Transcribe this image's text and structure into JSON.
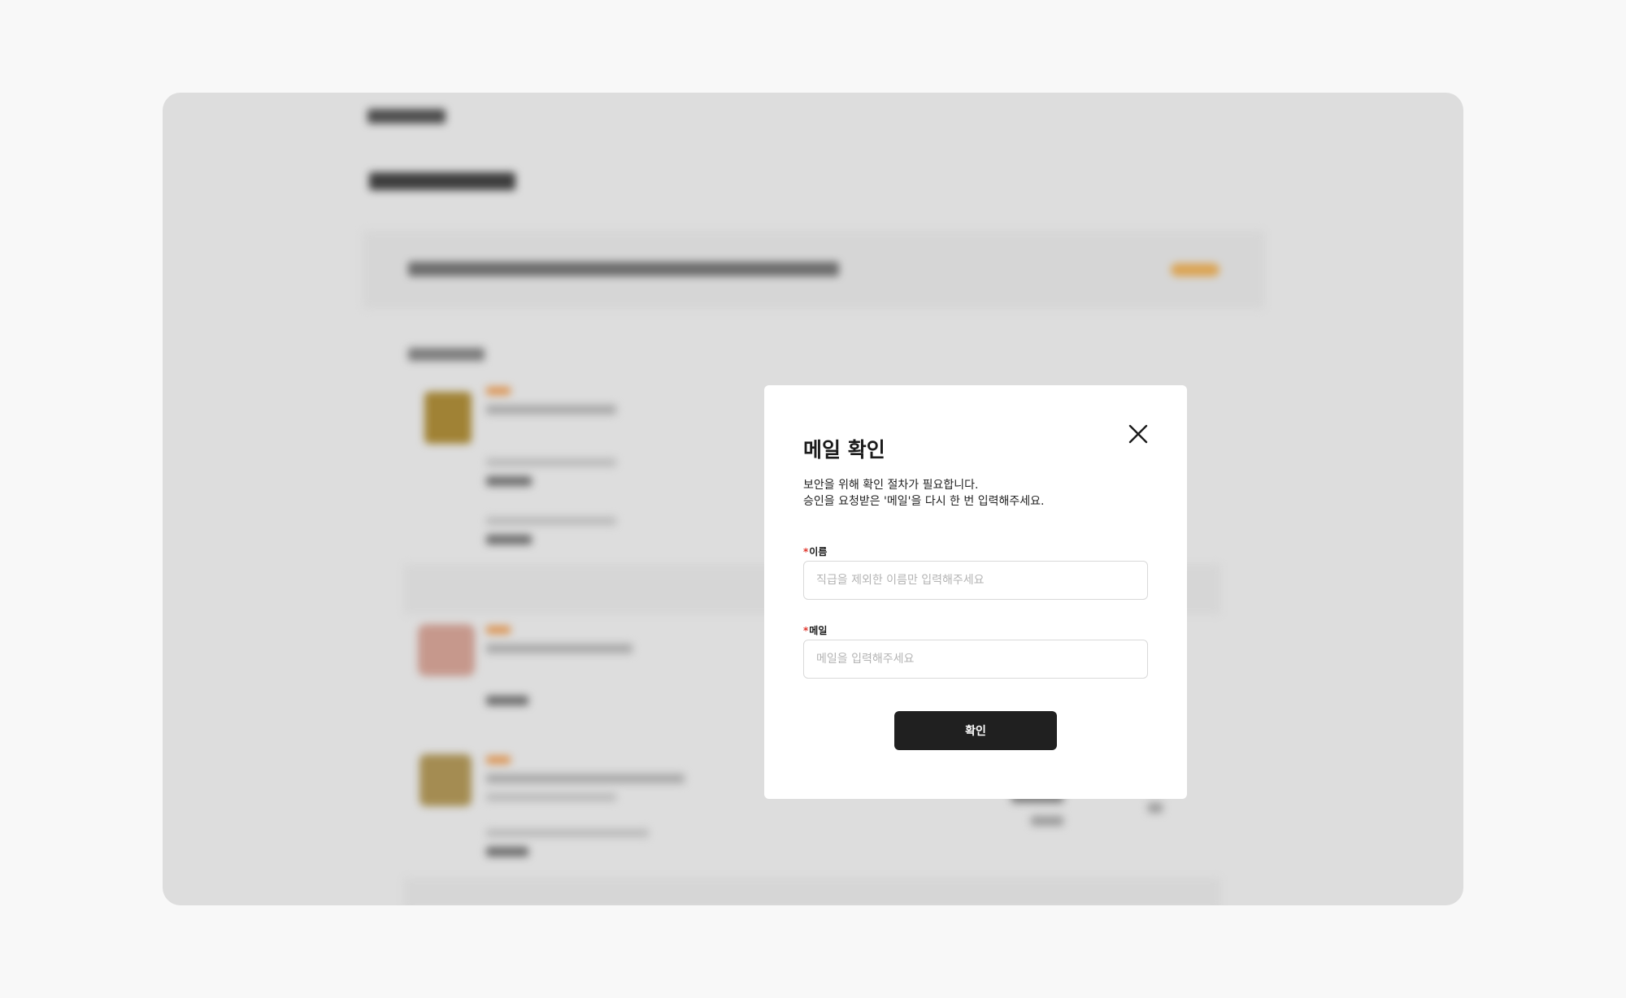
{
  "dialog": {
    "title": "메일 확인",
    "description_line1": "보안을 위해 확인 절차가 필요합니다.",
    "description_line2": "승인을 요청받은 '메일'을 다시 한 번 입력해주세요.",
    "name_field": {
      "required_mark": "*",
      "label": "이름",
      "value": "",
      "placeholder": "직급을 제외한 이름만 입력해주세요"
    },
    "email_field": {
      "required_mark": "*",
      "label": "메일",
      "value": "",
      "placeholder": "메일을 입력해주세요"
    },
    "confirm_label": "확인",
    "close_icon": "close-icon"
  },
  "colors": {
    "page_background": "#f8f8f8",
    "primary_button": "#202020",
    "required_mark": "#e0352b",
    "background_accent": "#f0b35a"
  }
}
